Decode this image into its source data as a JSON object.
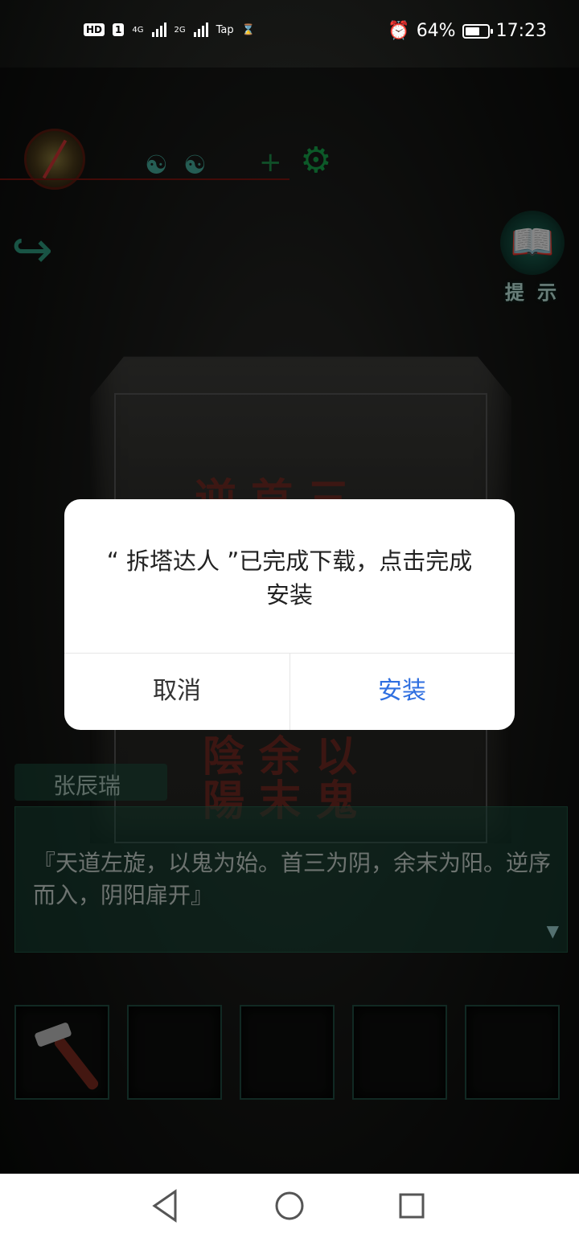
{
  "status_bar": {
    "hd": "HD",
    "sim": "1",
    "net1": "4G",
    "net2": "2G",
    "app_badge": "Tap",
    "alarm_icon": "alarm-icon",
    "battery_percent": "64%",
    "battery_level": 0.64,
    "time": "17:23"
  },
  "game": {
    "hint_label": "提 示",
    "speaker": "张辰瑞",
    "dialog_text": "『天道左旋，以鬼为始。首三为阴，余末为阳。逆序而入，阴阳扉开』",
    "tablet_chars_top": "逆 首 三",
    "tablet_chars_bottom1": "陰 余 以",
    "tablet_chars_bottom2": "陽 末 鬼"
  },
  "modal": {
    "message": "“ 拆塔达人 ”已完成下载，点击完成安装",
    "cancel_label": "取消",
    "install_label": "安装",
    "accent": "#2f6fe0"
  },
  "navbar": {
    "back_icon": "back-triangle-icon",
    "home_icon": "home-circle-icon",
    "recents_icon": "recents-square-icon"
  }
}
